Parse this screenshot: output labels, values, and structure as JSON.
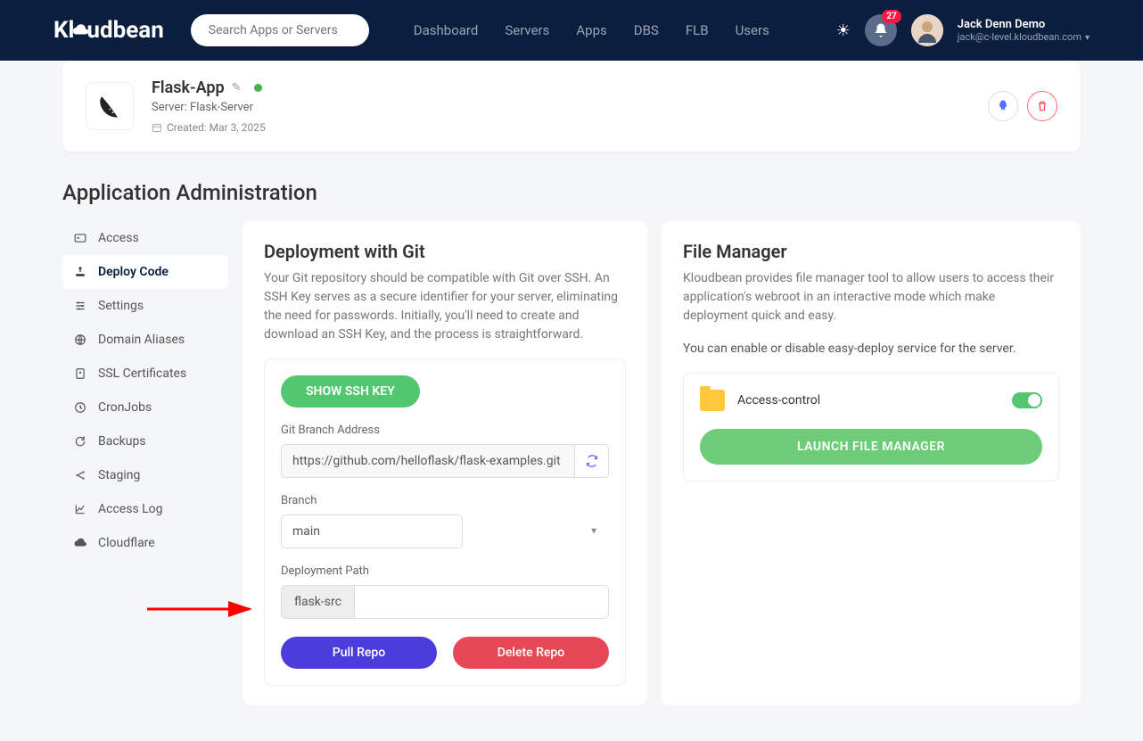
{
  "header": {
    "logo_text": "Kloudbean",
    "search_placeholder": "Search Apps or Servers",
    "nav": [
      "Dashboard",
      "Servers",
      "Apps",
      "DBS",
      "FLB",
      "Users"
    ],
    "notification_count": "27",
    "user_name": "Jack Denn Demo",
    "user_email": "jack@c-level.kloudbean.com"
  },
  "app": {
    "name": "Flask-App",
    "server": "Server: Flask-Server",
    "created": "Created: Mar 3, 2025"
  },
  "section_title": "Application Administration",
  "sidebar": {
    "items": [
      {
        "label": "Access"
      },
      {
        "label": "Deploy Code"
      },
      {
        "label": "Settings"
      },
      {
        "label": "Domain Aliases"
      },
      {
        "label": "SSL Certificates"
      },
      {
        "label": "CronJobs"
      },
      {
        "label": "Backups"
      },
      {
        "label": "Staging"
      },
      {
        "label": "Access Log"
      },
      {
        "label": "Cloudflare"
      }
    ]
  },
  "git": {
    "title": "Deployment with Git",
    "desc": "Your Git repository should be compatible with Git over SSH. An SSH Key serves as a secure identifier for your server, eliminating the need for passwords. Initially, you'll need to create and download an SSH Key, and the process is straightforward.",
    "show_ssh": "SHOW SSH KEY",
    "branch_addr_label": "Git Branch Address",
    "branch_addr_value": "https://github.com/helloflask/flask-examples.git",
    "branch_label": "Branch",
    "branch_value": "main",
    "path_label": "Deployment Path",
    "path_value": "flask-src",
    "pull_btn": "Pull Repo",
    "delete_btn": "Delete Repo"
  },
  "fm": {
    "title": "File Manager",
    "desc": "Kloudbean provides file manager tool to allow users to access their application's webroot in an interactive mode which make deployment quick and easy.",
    "note": "You can enable or disable easy-deploy service for the server.",
    "item_label": "Access-control",
    "launch_btn": "LAUNCH FILE MANAGER"
  }
}
